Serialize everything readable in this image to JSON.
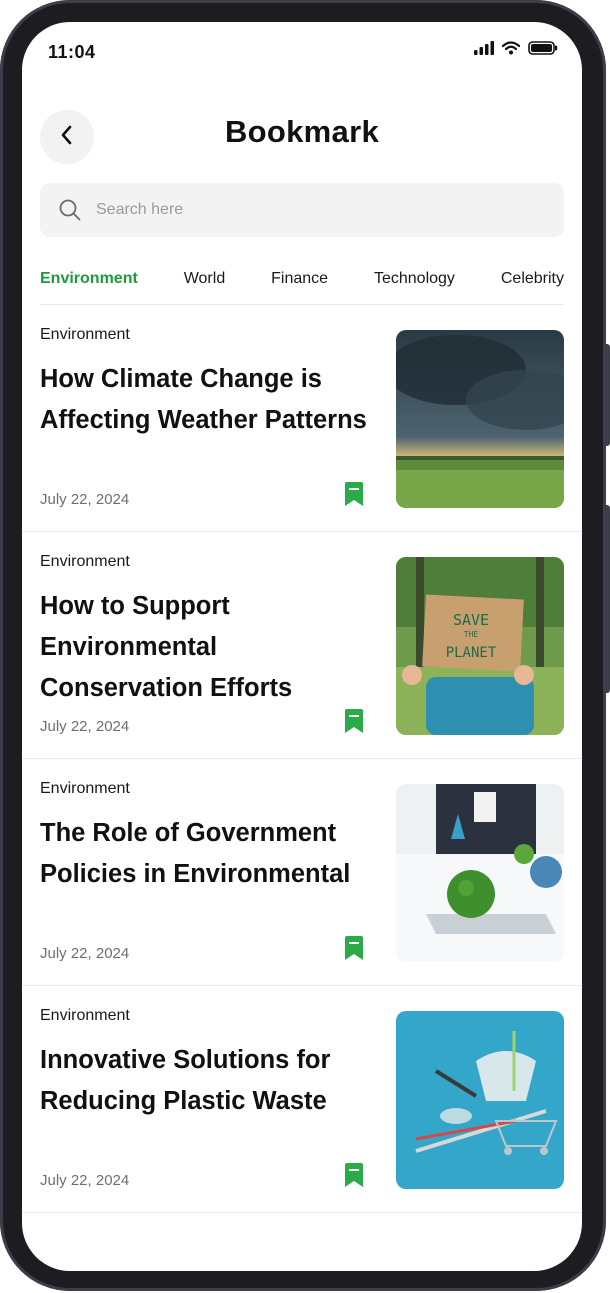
{
  "status_bar": {
    "time": "11:04"
  },
  "header": {
    "title": "Bookmark"
  },
  "search": {
    "placeholder": "Search here",
    "value": ""
  },
  "tabs": [
    {
      "label": "Environment",
      "active": true
    },
    {
      "label": "World",
      "active": false
    },
    {
      "label": "Finance",
      "active": false
    },
    {
      "label": "Technology",
      "active": false
    },
    {
      "label": "Celebrity",
      "active": false
    }
  ],
  "articles": [
    {
      "category": "Environment",
      "title": "How Climate Change is Affecting Weather Patterns",
      "date": "July 22, 2024",
      "image": "storm-clouds-field"
    },
    {
      "category": "Environment",
      "title": "How to Support Environmental Conservation Efforts",
      "date": "July 22, 2024",
      "image": "save-the-planet-sign",
      "image_text": [
        "SAVE",
        "THE",
        "PLANET"
      ]
    },
    {
      "category": "Environment",
      "title": "The Role of Government Policies in Environmental",
      "date": "July 22, 2024",
      "image": "green-globe-meeting"
    },
    {
      "category": "Environment",
      "title": "Innovative Solutions for Reducing Plastic Waste",
      "date": "July 22, 2024",
      "image": "plastic-waste-cart"
    }
  ],
  "colors": {
    "accent": "#1f9a3a",
    "bookmark": "#2bab47"
  }
}
